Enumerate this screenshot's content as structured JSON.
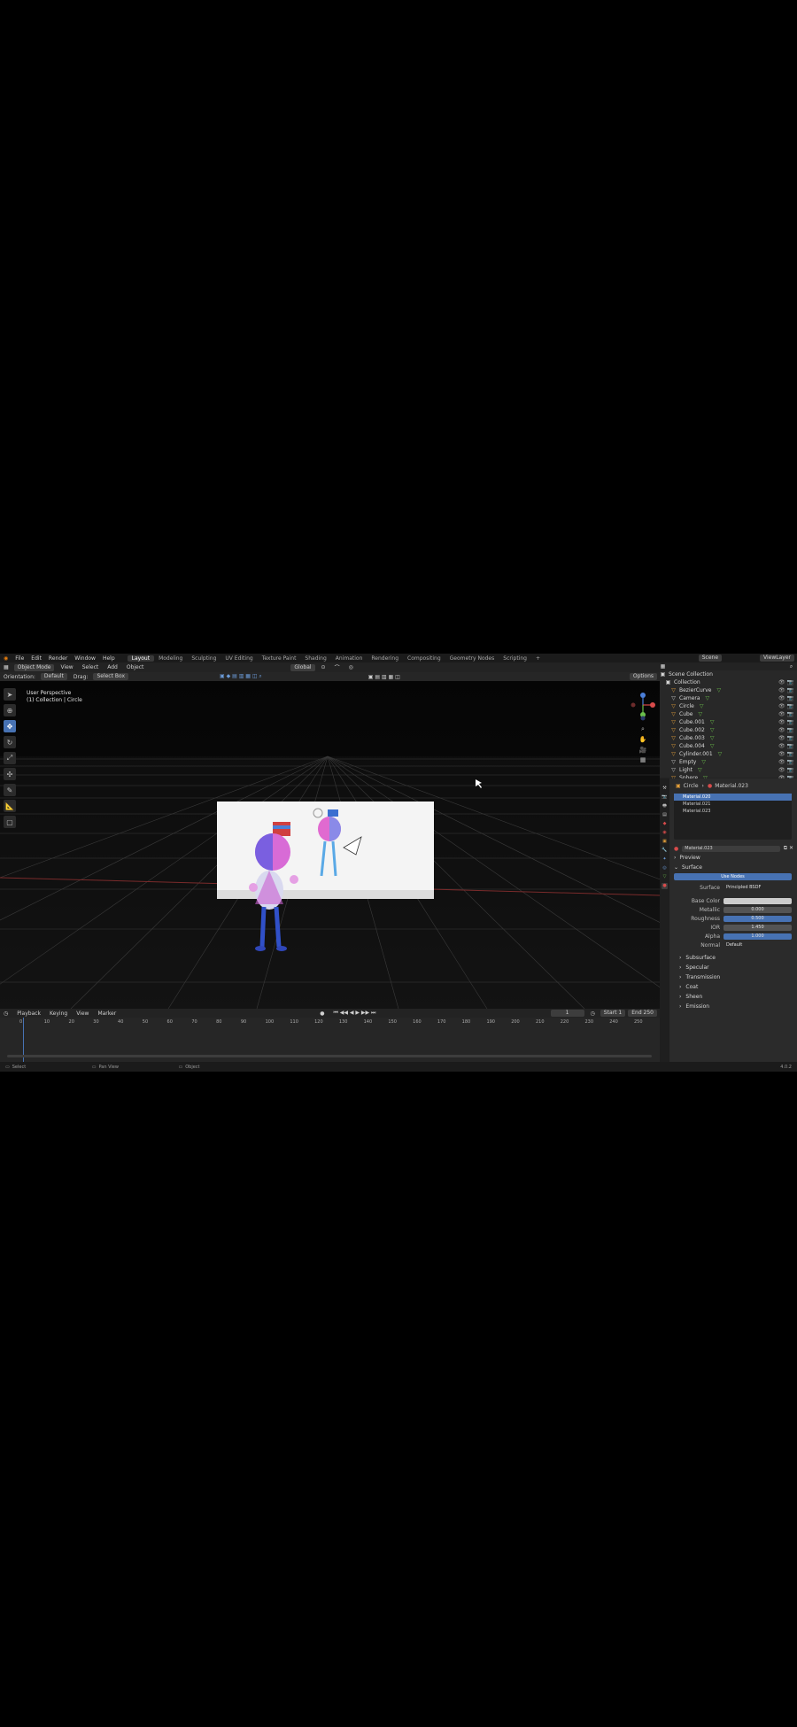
{
  "menubar": {
    "menus": [
      "File",
      "Edit",
      "Render",
      "Window",
      "Help"
    ],
    "workspaces": [
      "Layout",
      "Modeling",
      "Sculpting",
      "UV Editing",
      "Texture Paint",
      "Shading",
      "Animation",
      "Rendering",
      "Compositing",
      "Geometry Nodes",
      "Scripting"
    ],
    "active_workspace": "Layout",
    "scene_label": "Scene",
    "viewlayer_label": "ViewLayer"
  },
  "header": {
    "mode": "Object Mode",
    "menus": [
      "View",
      "Select",
      "Add",
      "Object"
    ],
    "transform": "Global"
  },
  "tool_settings": {
    "orientation_label": "Orientation:",
    "orientation_value": "Default",
    "drag_label": "Drag:",
    "drag_value": "Select Box",
    "options_label": "Options"
  },
  "viewport": {
    "perspective": "User Perspective",
    "collection": "(1) Collection | Circle"
  },
  "outliner": {
    "root": "Scene Collection",
    "collection": "Collection",
    "items": [
      "BezierCurve",
      "Camera",
      "Circle",
      "Cube",
      "Cube.001",
      "Cube.002",
      "Cube.003",
      "Cube.004",
      "Cylinder.001",
      "Empty",
      "Light",
      "Sphere"
    ]
  },
  "properties": {
    "breadcrumb_object": "Circle",
    "breadcrumb_material": "Material.023",
    "slots": [
      "Material.020",
      "Material.021",
      "Material.023"
    ],
    "material_name": "Material.023",
    "preview_label": "Preview",
    "surface_label": "Surface",
    "use_nodes": "Use Nodes",
    "surface_field_label": "Surface",
    "surface_value": "Principled BSDF",
    "fields": [
      {
        "label": "Base Color",
        "value": ""
      },
      {
        "label": "Metallic",
        "value": "0.000"
      },
      {
        "label": "Roughness",
        "value": "0.500"
      },
      {
        "label": "IOR",
        "value": "1.450"
      },
      {
        "label": "Alpha",
        "value": "1.000"
      },
      {
        "label": "Normal",
        "value": "Default"
      }
    ],
    "sections": [
      "Subsurface",
      "Specular",
      "Transmission",
      "Coat",
      "Sheen",
      "Emission"
    ]
  },
  "timeline": {
    "menus": [
      "Playback",
      "Keying",
      "View",
      "Marker"
    ],
    "current_frame": "1",
    "start_label": "Start",
    "start_value": "1",
    "end_label": "End",
    "end_value": "250",
    "ticks": [
      "0",
      "10",
      "20",
      "30",
      "40",
      "50",
      "60",
      "70",
      "80",
      "90",
      "100",
      "110",
      "120",
      "130",
      "140",
      "150",
      "160",
      "170",
      "180",
      "190",
      "200",
      "210",
      "220",
      "230",
      "240",
      "250"
    ]
  },
  "status": {
    "select": "Select",
    "pan": "Pan View",
    "object": "Object",
    "version": "4.0.2"
  }
}
